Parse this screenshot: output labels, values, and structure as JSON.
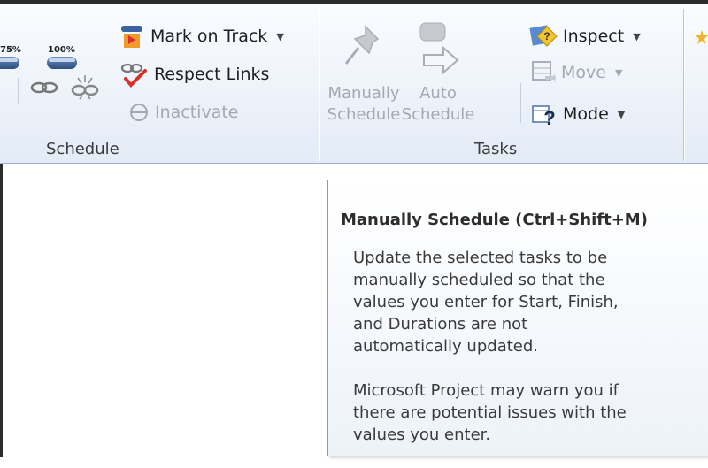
{
  "ribbon": {
    "schedule_group": {
      "label": "Schedule",
      "pct_75": "75%",
      "pct_100": "100%",
      "mark_on_track": "Mark on Track",
      "respect_links": "Respect Links",
      "inactivate": "Inactivate"
    },
    "tasks_group": {
      "label": "Tasks",
      "manually_schedule": [
        "Manually",
        "Schedule"
      ],
      "auto_schedule": [
        "Auto",
        "Schedule"
      ],
      "inspect": "Inspect",
      "move": "Move",
      "mode": "Mode"
    }
  },
  "tooltip": {
    "title": "Manually Schedule (Ctrl+Shift+M)",
    "lines_1": [
      "Update the selected tasks to be",
      "manually scheduled so that the",
      "values you enter for Start, Finish,",
      "and Durations are not",
      "automatically updated."
    ],
    "lines_2": [
      "Microsoft Project may warn you if",
      "there are potential issues with the",
      "values you enter."
    ]
  },
  "colors": {
    "ribbon_bg": "#eef3fa",
    "disabled_text": "#a4a9b1",
    "tooltip_border": "#8a9aae",
    "accent_red": "#d9302a",
    "accent_orange": "#f0a020"
  }
}
